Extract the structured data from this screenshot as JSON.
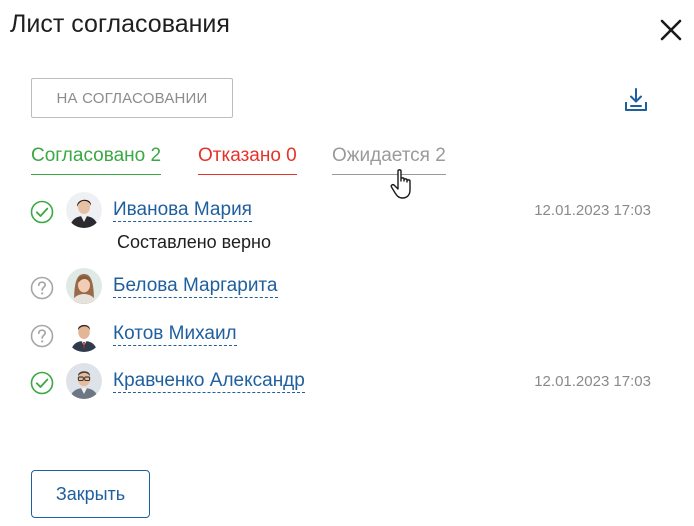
{
  "dialog": {
    "title": "Лист согласования",
    "status_badge": "НА СОГЛАСОВАНИИ",
    "close_icon": "close-icon",
    "download_icon": "download-icon"
  },
  "tabs": [
    {
      "label": "Согласовано 2",
      "color": "#3aa843"
    },
    {
      "label": "Отказано 0",
      "color": "#e5332a"
    },
    {
      "label": "Ожидается 2",
      "color": "#9a9a9a"
    }
  ],
  "approvers": [
    {
      "name": "Иванова Мария",
      "status": "approved",
      "status_icon": "check-circle-icon",
      "date": "12.01.2023 17:03",
      "comment": "Составлено верно"
    },
    {
      "name": "Белова Маргарита",
      "status": "pending",
      "status_icon": "question-circle-icon",
      "date": "",
      "comment": ""
    },
    {
      "name": "Котов Михаил",
      "status": "pending",
      "status_icon": "question-circle-icon",
      "date": "",
      "comment": ""
    },
    {
      "name": "Кравченко Александр",
      "status": "approved",
      "status_icon": "check-circle-icon",
      "date": "12.01.2023 17:03",
      "comment": ""
    }
  ],
  "footer": {
    "close_button": "Закрыть"
  },
  "colors": {
    "link": "#1f5f9e",
    "approved": "#3aa843",
    "rejected": "#e5332a",
    "muted": "#9a9a9a"
  }
}
